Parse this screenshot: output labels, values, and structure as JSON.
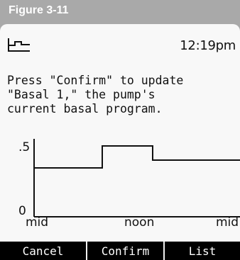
{
  "figure": {
    "label": "Figure 3-11"
  },
  "status_bar": {
    "icon": "basal-program-icon",
    "time": "12:19pm"
  },
  "message": {
    "lines": [
      "Press \"Confirm\" to update",
      "\"Basal 1,\" the pump's",
      "current basal program."
    ]
  },
  "graph": {
    "y_top_label": ".5",
    "y_bottom_label": "0",
    "x_labels": [
      "mid",
      "noon",
      "mid"
    ]
  },
  "softkeys": {
    "left": "Cancel",
    "center": "Confirm",
    "right": "List"
  },
  "colors": {
    "frame": "#a9a9a9",
    "screen": "#f8f8f8",
    "softkey_bar": "#000000",
    "text": "#111111"
  }
}
